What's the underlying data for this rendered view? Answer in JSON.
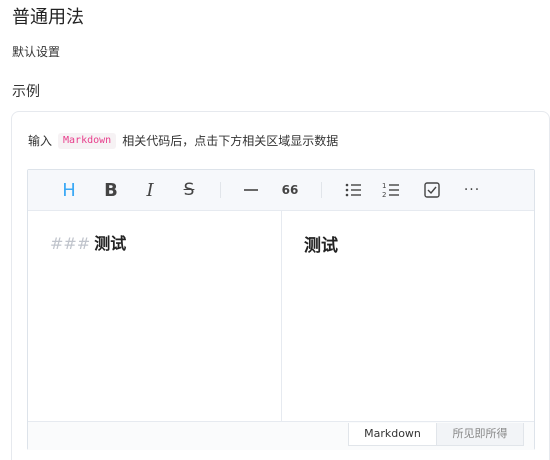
{
  "heading": "普通用法",
  "subtitle": "默认设置",
  "section_title": "示例",
  "description": {
    "before": "输入",
    "code": "Markdown",
    "after": "相关代码后，点击下方相关区域显示数据"
  },
  "toolbar": {
    "items": [
      {
        "name": "heading-icon",
        "glyph": "H",
        "color": "#3ba9f5"
      },
      {
        "name": "bold-icon",
        "glyph": "B"
      },
      {
        "name": "italic-icon",
        "glyph": "I"
      },
      {
        "name": "strikethrough-icon",
        "glyph": "S"
      },
      {
        "name": "horizontal-rule-icon",
        "glyph": "—"
      },
      {
        "name": "quote-icon",
        "glyph": "66"
      },
      {
        "name": "bullet-list-icon",
        "glyph": "☰"
      },
      {
        "name": "ordered-list-icon",
        "glyph": "≡"
      },
      {
        "name": "checkbox-icon",
        "glyph": "☑"
      },
      {
        "name": "more-icon",
        "glyph": "···"
      }
    ]
  },
  "editor": {
    "source_hash": "###",
    "source_text": "测试",
    "preview_text": "测试"
  },
  "modes": {
    "markdown": "Markdown",
    "wysiwyg": "所见即所得"
  },
  "colors": {
    "accent": "#3ba9f5",
    "code_text": "#e83e8c",
    "code_bg": "#f6f2f4"
  }
}
